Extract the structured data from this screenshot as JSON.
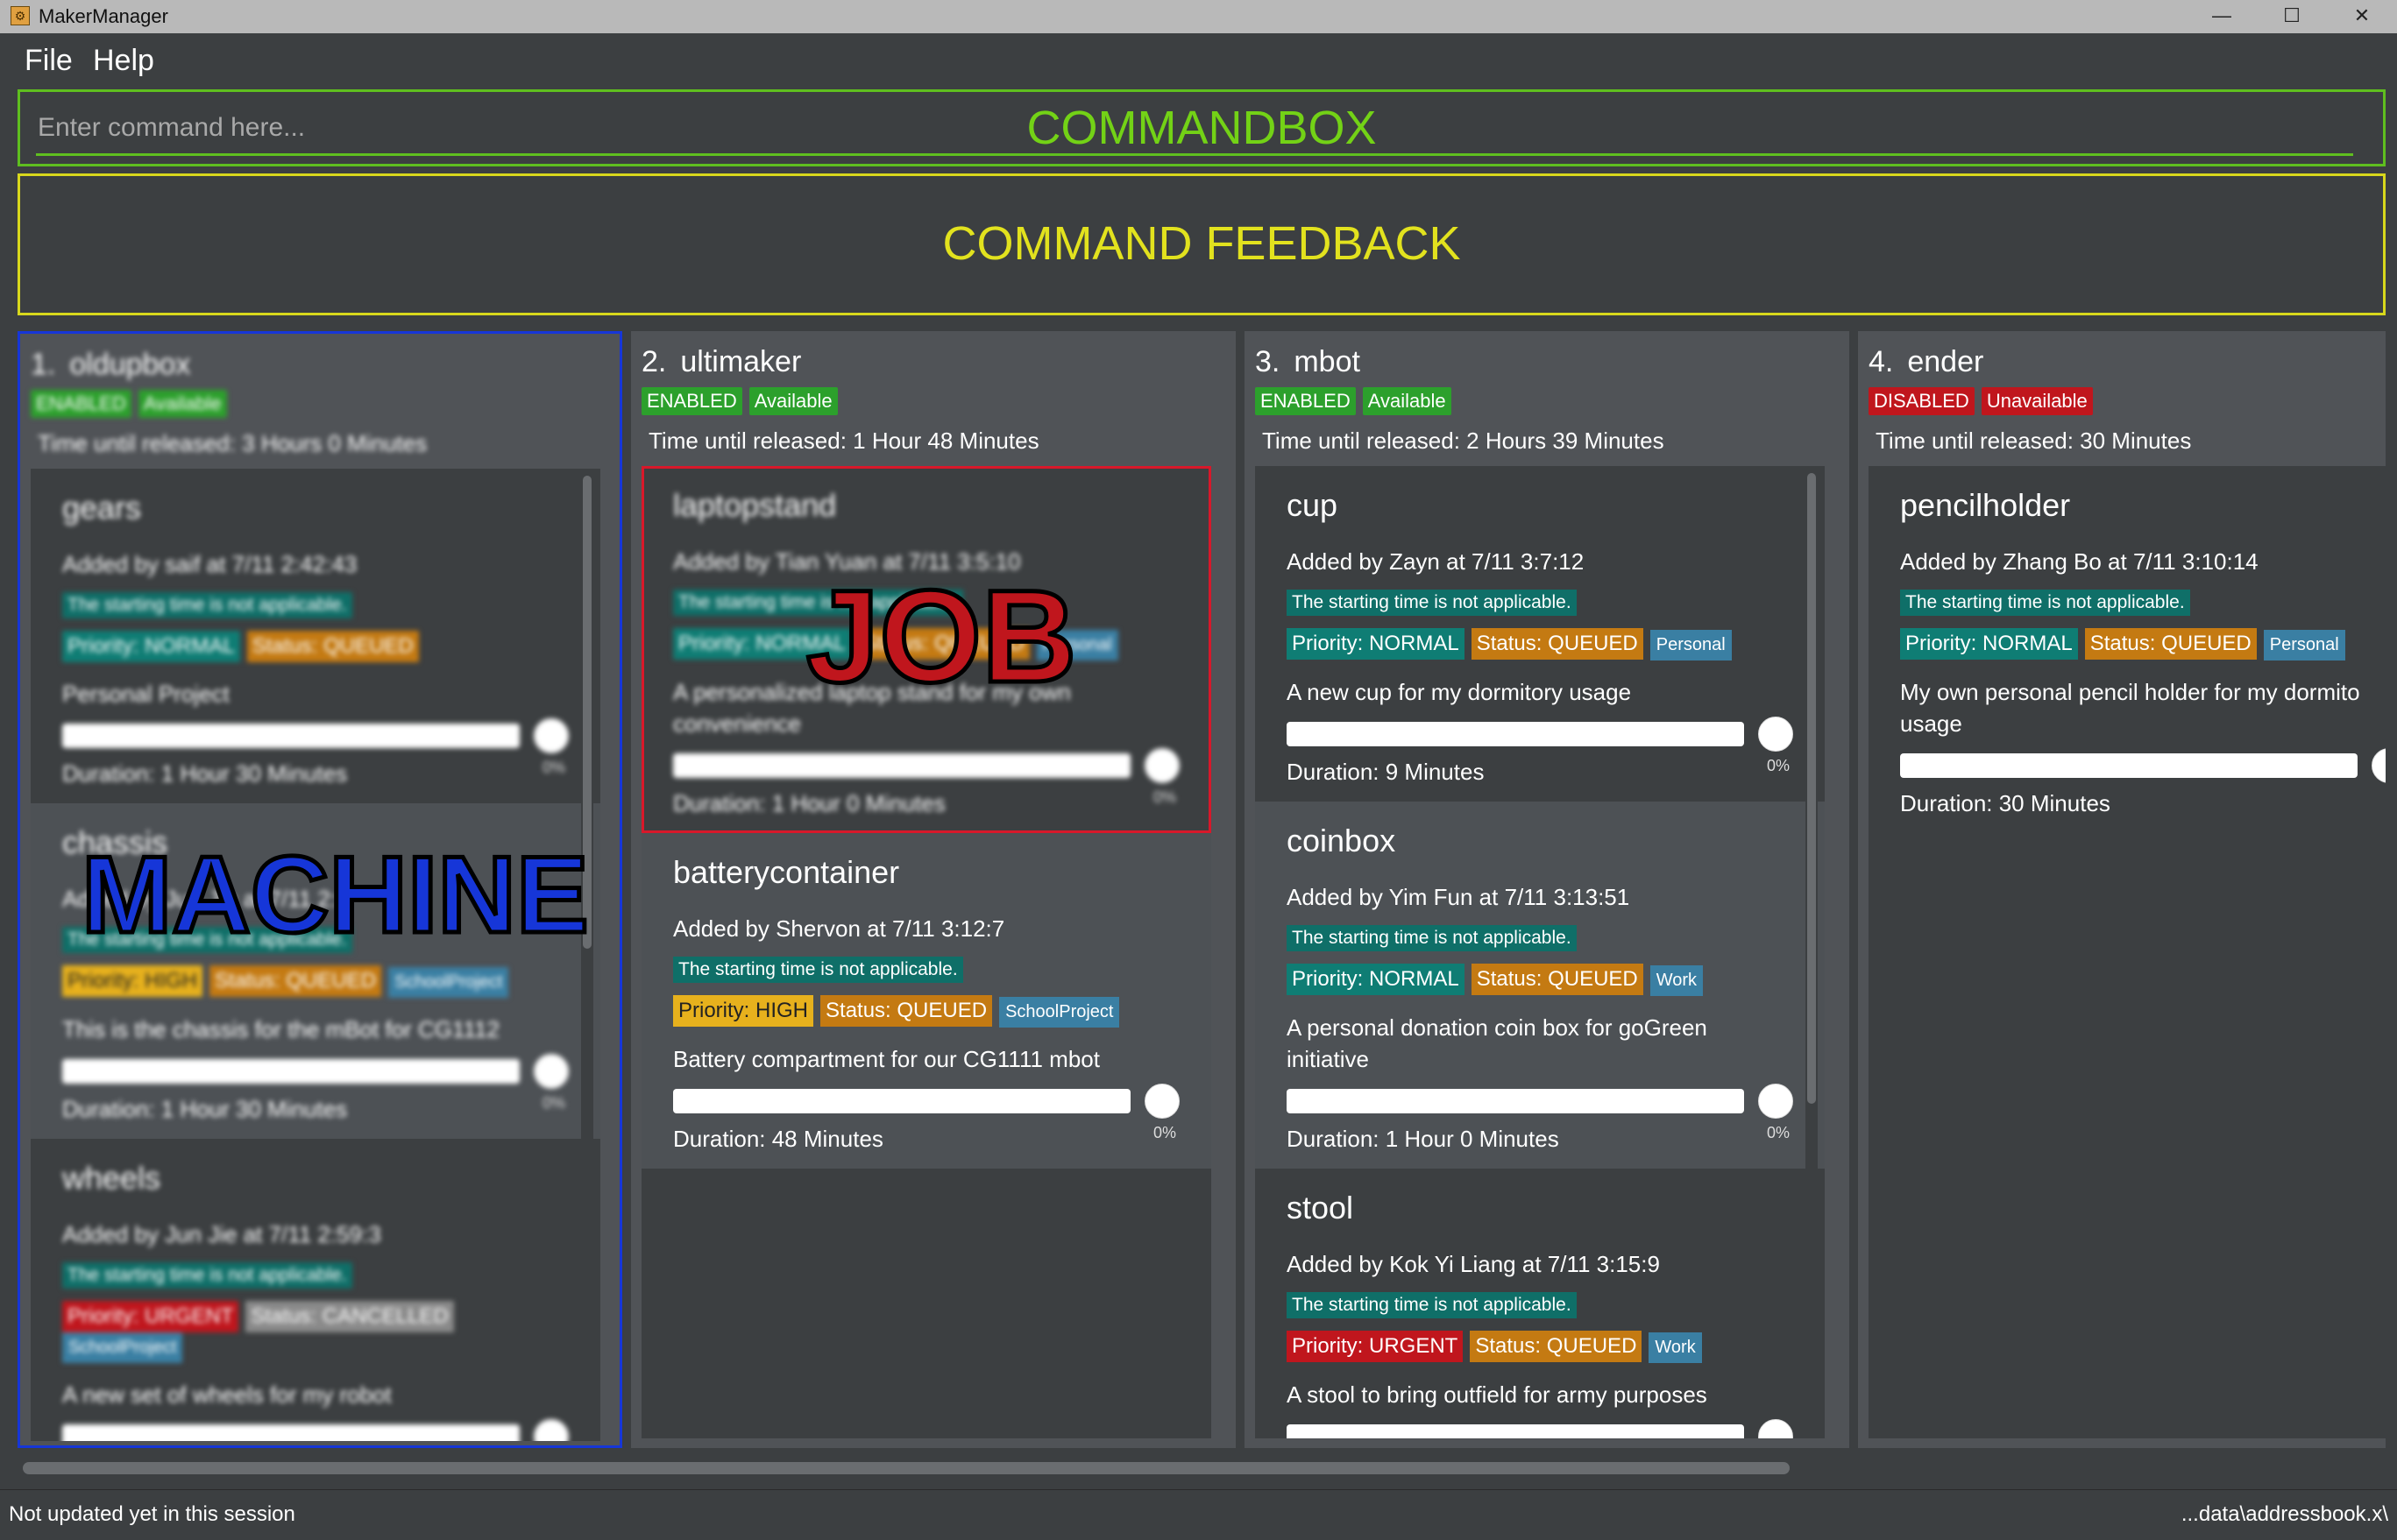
{
  "window": {
    "title": "MakerManager",
    "minimize_glyph": "—",
    "maximize_glyph": "☐",
    "close_glyph": "✕"
  },
  "menu": {
    "file": "File",
    "help": "Help"
  },
  "command_box": {
    "placeholder": "Enter command here...",
    "overlay_label": "COMMANDBOX",
    "accent_color": "#5fbf1f"
  },
  "feedback": {
    "overlay_label": "COMMAND FEEDBACK",
    "accent_color": "#d8d81c"
  },
  "overlays": {
    "machine_label": "MACHINE",
    "machine_color": "#1636d8",
    "job_label": "JOB",
    "job_color": "#c0161d"
  },
  "machines": [
    {
      "index": "1.",
      "name": "oldupbox",
      "status": "ENABLED",
      "availability": "Available",
      "release": "Time until released: 3 Hours 0 Minutes",
      "jobs": [
        {
          "name": "gears",
          "added": "Added by saif at 7/11 2:42:43",
          "starting": "The starting time is not applicable.",
          "priority": "Priority: NORMAL",
          "status": "Status: QUEUED",
          "project": "",
          "description": "Personal Project",
          "progress": 0,
          "percent": "0%",
          "duration": "Duration: 1 Hour 30 Minutes"
        },
        {
          "name": "chassis",
          "added": "Added by Jun Jie at 7/11 2:5",
          "starting": "The starting time is not applicable.",
          "priority": "Priority: HIGH",
          "status": "Status: QUEUED",
          "project": "SchoolProject",
          "description": "This is the chassis for the mBot for CG1112",
          "progress": 0,
          "percent": "0%",
          "duration": "Duration: 1 Hour 30 Minutes"
        },
        {
          "name": "wheels",
          "added": "Added by Jun Jie at 7/11 2:59:3",
          "starting": "The starting time is not applicable.",
          "priority": "Priority: URGENT",
          "status": "Status: CANCELLED",
          "project": "SchoolProject",
          "description": "A new set of wheels for my robot",
          "progress": 0,
          "percent": "0%",
          "duration": ""
        }
      ]
    },
    {
      "index": "2.",
      "name": "ultimaker",
      "status": "ENABLED",
      "availability": "Available",
      "release": "Time until released: 1 Hour 48 Minutes",
      "jobs": [
        {
          "name": "laptopstand",
          "added": "Added by Tian Yuan at 7/11 3:5:10",
          "starting": "The starting time is not applicable.",
          "priority": "Priority: NORMAL",
          "status": "Status: QUEUED",
          "project": "Personal",
          "description": "A personalized laptop stand for my own convenience",
          "progress": 0,
          "percent": "0%",
          "duration": "Duration: 1 Hour 0 Minutes"
        },
        {
          "name": "batterycontainer",
          "added": "Added by Shervon at 7/11 3:12:7",
          "starting": "The starting time is not applicable.",
          "priority": "Priority: HIGH",
          "status": "Status: QUEUED",
          "project": "SchoolProject",
          "description": "Battery compartment for our CG1111 mbot",
          "progress": 0,
          "percent": "0%",
          "duration": "Duration: 48 Minutes"
        }
      ]
    },
    {
      "index": "3.",
      "name": "mbot",
      "status": "ENABLED",
      "availability": "Available",
      "release": "Time until released: 2 Hours 39 Minutes",
      "jobs": [
        {
          "name": "cup",
          "added": "Added by Zayn at 7/11 3:7:12",
          "starting": "The starting time is not applicable.",
          "priority": "Priority: NORMAL",
          "status": "Status: QUEUED",
          "project": "Personal",
          "description": "A new cup for my dormitory usage",
          "progress": 0,
          "percent": "0%",
          "duration": "Duration: 9 Minutes"
        },
        {
          "name": "coinbox",
          "added": "Added by Yim Fun at 7/11 3:13:51",
          "starting": "The starting time is not applicable.",
          "priority": "Priority: NORMAL",
          "status": "Status: QUEUED",
          "project": "Work",
          "description": "A personal donation coin box for goGreen initiative",
          "progress": 0,
          "percent": "0%",
          "duration": "Duration: 1 Hour 0 Minutes"
        },
        {
          "name": "stool",
          "added": "Added by Kok Yi Liang at 7/11 3:15:9",
          "starting": "The starting time is not applicable.",
          "priority": "Priority: URGENT",
          "status": "Status: QUEUED",
          "project": "Work",
          "description": "A stool to bring outfield for army purposes",
          "progress": 0,
          "percent": "",
          "duration": ""
        }
      ]
    },
    {
      "index": "4.",
      "name": "ender",
      "status": "DISABLED",
      "availability": "Unavailable",
      "release": "Time until released: 30 Minutes",
      "jobs": [
        {
          "name": "pencilholder",
          "added": "Added by Zhang Bo at 7/11 3:10:14",
          "starting": "The starting time is not applicable.",
          "priority": "Priority: NORMAL",
          "status": "Status: QUEUED",
          "project": "Personal",
          "description": "My own personal pencil holder for my dormito usage",
          "progress": 0,
          "percent": "",
          "duration": "Duration: 30 Minutes"
        }
      ]
    }
  ],
  "status_bar": {
    "left": "Not updated yet in this session",
    "right": "...data\\addressbook.x\\"
  }
}
